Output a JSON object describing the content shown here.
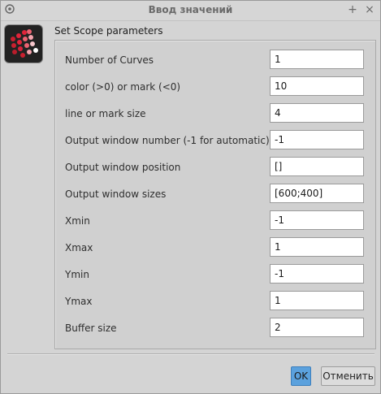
{
  "window": {
    "title": "Ввод значений"
  },
  "titlebar": {
    "menu_icon": "window-menu-icon",
    "maximize_icon": "maximize-icon",
    "close_icon": "close-icon"
  },
  "dialog": {
    "header": "Set Scope parameters",
    "fields": [
      {
        "label": "Number of Curves",
        "value": "1"
      },
      {
        "label": "color (>0) or mark (<0)",
        "value": "10"
      },
      {
        "label": "line or mark size",
        "value": "4"
      },
      {
        "label": "Output window number (-1 for automatic)",
        "value": "-1"
      },
      {
        "label": "Output window position",
        "value": "[]"
      },
      {
        "label": "Output window sizes",
        "value": "[600;400]"
      },
      {
        "label": "Xmin",
        "value": "-1"
      },
      {
        "label": "Xmax",
        "value": "1"
      },
      {
        "label": "Ymin",
        "value": "-1"
      },
      {
        "label": "Ymax",
        "value": "1"
      },
      {
        "label": "Buffer size",
        "value": "2"
      }
    ]
  },
  "buttons": {
    "ok": "OK",
    "cancel": "Отменить"
  },
  "colors": {
    "accent": "#5ba1dd",
    "logo_bg": "#222222",
    "logo_dot": "#e0243a"
  }
}
